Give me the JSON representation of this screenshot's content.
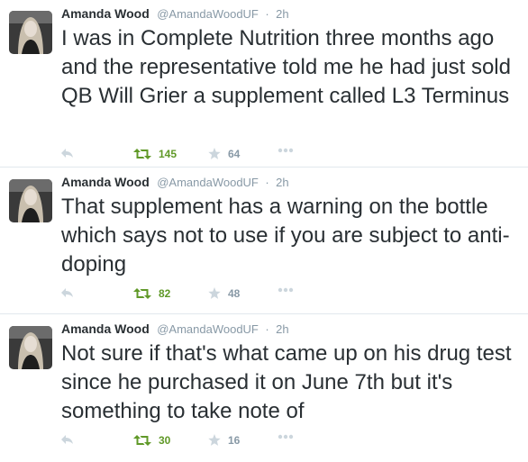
{
  "colors": {
    "text": "#292f33",
    "muted": "#8899a6",
    "retweet_green": "#609928",
    "icon_gray": "#ccd6dd",
    "divider": "#e1e8ed"
  },
  "icons": {
    "reply": "reply-icon",
    "retweet": "retweet-icon",
    "favorite": "star-icon",
    "more": "ellipsis-icon"
  },
  "tweets": [
    {
      "name": "Amanda Wood",
      "handle": "@AmandaWoodUF",
      "separator": "·",
      "time": "2h",
      "text": "I was in Complete Nutrition three months ago and the representative told me he had just sold QB Will Grier a supplement called L3 Terminus",
      "retweets": "145",
      "favorites": "64"
    },
    {
      "name": "Amanda Wood",
      "handle": "@AmandaWoodUF",
      "separator": "·",
      "time": "2h",
      "text": "That supplement has a warning on the bottle which says not to use if you are subject to anti-doping",
      "retweets": "82",
      "favorites": "48"
    },
    {
      "name": "Amanda Wood",
      "handle": "@AmandaWoodUF",
      "separator": "·",
      "time": "2h",
      "text": "Not sure if that's what came up on his drug test since he purchased it on June 7th but it's something to take note of",
      "retweets": "30",
      "favorites": "16"
    }
  ]
}
